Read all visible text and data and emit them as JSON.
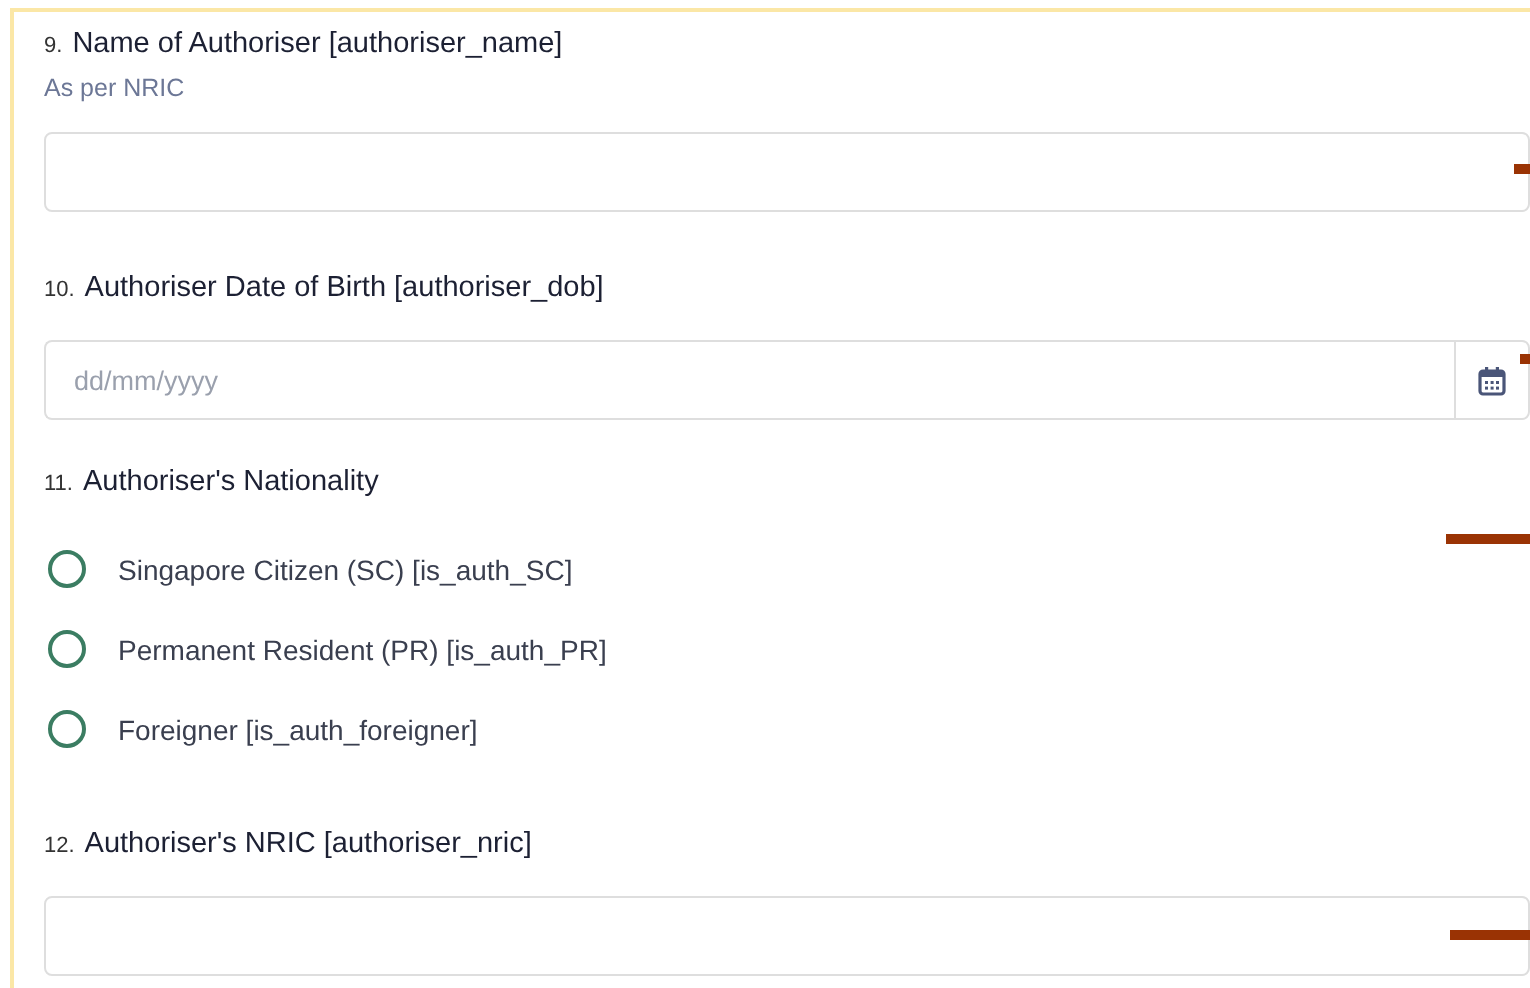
{
  "questions": [
    {
      "kind": "text",
      "number": "9.",
      "label": "Name of Authoriser [authoriser_name]",
      "hint": "As per NRIC"
    },
    {
      "kind": "date",
      "number": "10.",
      "label": "Authoriser Date of Birth [authoriser_dob]",
      "placeholder": "dd/mm/yyyy"
    },
    {
      "kind": "radio",
      "number": "11.",
      "label": "Authoriser's Nationality",
      "options": [
        {
          "label": "Singapore Citizen (SC) [is_auth_SC]",
          "selected": false
        },
        {
          "label": "Permanent Resident (PR) [is_auth_PR]",
          "selected": false
        },
        {
          "label": "Foreigner [is_auth_foreigner]",
          "selected": false
        }
      ]
    },
    {
      "kind": "text",
      "number": "12.",
      "label": "Authoriser's NRIC [authoriser_nric]"
    }
  ]
}
